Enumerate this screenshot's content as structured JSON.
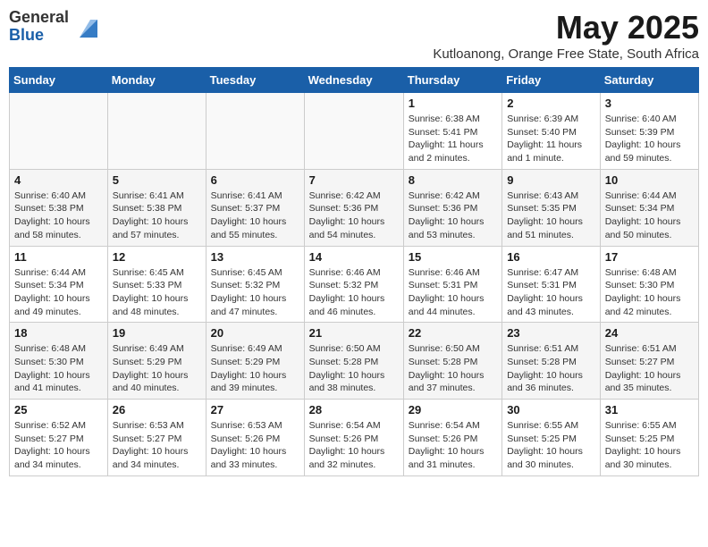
{
  "logo": {
    "general": "General",
    "blue": "Blue"
  },
  "title": "May 2025",
  "subtitle": "Kutloanong, Orange Free State, South Africa",
  "days_header": [
    "Sunday",
    "Monday",
    "Tuesday",
    "Wednesday",
    "Thursday",
    "Friday",
    "Saturday"
  ],
  "weeks": [
    [
      {
        "num": "",
        "info": ""
      },
      {
        "num": "",
        "info": ""
      },
      {
        "num": "",
        "info": ""
      },
      {
        "num": "",
        "info": ""
      },
      {
        "num": "1",
        "info": "Sunrise: 6:38 AM\nSunset: 5:41 PM\nDaylight: 11 hours\nand 2 minutes."
      },
      {
        "num": "2",
        "info": "Sunrise: 6:39 AM\nSunset: 5:40 PM\nDaylight: 11 hours\nand 1 minute."
      },
      {
        "num": "3",
        "info": "Sunrise: 6:40 AM\nSunset: 5:39 PM\nDaylight: 10 hours\nand 59 minutes."
      }
    ],
    [
      {
        "num": "4",
        "info": "Sunrise: 6:40 AM\nSunset: 5:38 PM\nDaylight: 10 hours\nand 58 minutes."
      },
      {
        "num": "5",
        "info": "Sunrise: 6:41 AM\nSunset: 5:38 PM\nDaylight: 10 hours\nand 57 minutes."
      },
      {
        "num": "6",
        "info": "Sunrise: 6:41 AM\nSunset: 5:37 PM\nDaylight: 10 hours\nand 55 minutes."
      },
      {
        "num": "7",
        "info": "Sunrise: 6:42 AM\nSunset: 5:36 PM\nDaylight: 10 hours\nand 54 minutes."
      },
      {
        "num": "8",
        "info": "Sunrise: 6:42 AM\nSunset: 5:36 PM\nDaylight: 10 hours\nand 53 minutes."
      },
      {
        "num": "9",
        "info": "Sunrise: 6:43 AM\nSunset: 5:35 PM\nDaylight: 10 hours\nand 51 minutes."
      },
      {
        "num": "10",
        "info": "Sunrise: 6:44 AM\nSunset: 5:34 PM\nDaylight: 10 hours\nand 50 minutes."
      }
    ],
    [
      {
        "num": "11",
        "info": "Sunrise: 6:44 AM\nSunset: 5:34 PM\nDaylight: 10 hours\nand 49 minutes."
      },
      {
        "num": "12",
        "info": "Sunrise: 6:45 AM\nSunset: 5:33 PM\nDaylight: 10 hours\nand 48 minutes."
      },
      {
        "num": "13",
        "info": "Sunrise: 6:45 AM\nSunset: 5:32 PM\nDaylight: 10 hours\nand 47 minutes."
      },
      {
        "num": "14",
        "info": "Sunrise: 6:46 AM\nSunset: 5:32 PM\nDaylight: 10 hours\nand 46 minutes."
      },
      {
        "num": "15",
        "info": "Sunrise: 6:46 AM\nSunset: 5:31 PM\nDaylight: 10 hours\nand 44 minutes."
      },
      {
        "num": "16",
        "info": "Sunrise: 6:47 AM\nSunset: 5:31 PM\nDaylight: 10 hours\nand 43 minutes."
      },
      {
        "num": "17",
        "info": "Sunrise: 6:48 AM\nSunset: 5:30 PM\nDaylight: 10 hours\nand 42 minutes."
      }
    ],
    [
      {
        "num": "18",
        "info": "Sunrise: 6:48 AM\nSunset: 5:30 PM\nDaylight: 10 hours\nand 41 minutes."
      },
      {
        "num": "19",
        "info": "Sunrise: 6:49 AM\nSunset: 5:29 PM\nDaylight: 10 hours\nand 40 minutes."
      },
      {
        "num": "20",
        "info": "Sunrise: 6:49 AM\nSunset: 5:29 PM\nDaylight: 10 hours\nand 39 minutes."
      },
      {
        "num": "21",
        "info": "Sunrise: 6:50 AM\nSunset: 5:28 PM\nDaylight: 10 hours\nand 38 minutes."
      },
      {
        "num": "22",
        "info": "Sunrise: 6:50 AM\nSunset: 5:28 PM\nDaylight: 10 hours\nand 37 minutes."
      },
      {
        "num": "23",
        "info": "Sunrise: 6:51 AM\nSunset: 5:28 PM\nDaylight: 10 hours\nand 36 minutes."
      },
      {
        "num": "24",
        "info": "Sunrise: 6:51 AM\nSunset: 5:27 PM\nDaylight: 10 hours\nand 35 minutes."
      }
    ],
    [
      {
        "num": "25",
        "info": "Sunrise: 6:52 AM\nSunset: 5:27 PM\nDaylight: 10 hours\nand 34 minutes."
      },
      {
        "num": "26",
        "info": "Sunrise: 6:53 AM\nSunset: 5:27 PM\nDaylight: 10 hours\nand 34 minutes."
      },
      {
        "num": "27",
        "info": "Sunrise: 6:53 AM\nSunset: 5:26 PM\nDaylight: 10 hours\nand 33 minutes."
      },
      {
        "num": "28",
        "info": "Sunrise: 6:54 AM\nSunset: 5:26 PM\nDaylight: 10 hours\nand 32 minutes."
      },
      {
        "num": "29",
        "info": "Sunrise: 6:54 AM\nSunset: 5:26 PM\nDaylight: 10 hours\nand 31 minutes."
      },
      {
        "num": "30",
        "info": "Sunrise: 6:55 AM\nSunset: 5:25 PM\nDaylight: 10 hours\nand 30 minutes."
      },
      {
        "num": "31",
        "info": "Sunrise: 6:55 AM\nSunset: 5:25 PM\nDaylight: 10 hours\nand 30 minutes."
      }
    ]
  ]
}
